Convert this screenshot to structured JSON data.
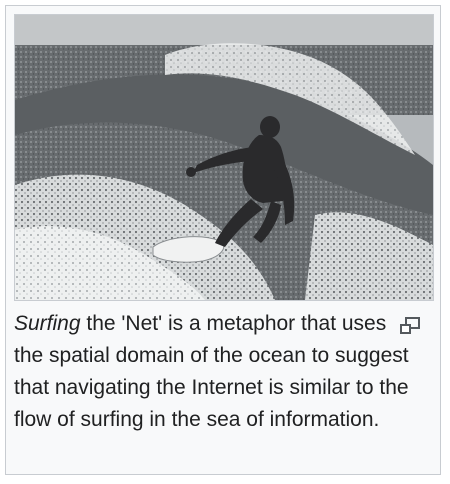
{
  "figure": {
    "image": {
      "subject": "surfer riding a wave",
      "palette": {
        "sky": "#aeb2b5",
        "water_dark": "#4f5356",
        "water_mid": "#7a7e81",
        "foam": "#e7e9ea",
        "figure": "#2a2a2c",
        "board": "#f1f2f2"
      }
    },
    "caption": {
      "lead_italic": "Surfing",
      "rest": " the 'Net' is a metaphor that uses the spatial domain of the ocean to suggest that navigating the Internet is similar to the flow of surfing in the sea of information."
    },
    "enlarge_icon": "magnify-clip-icon"
  }
}
